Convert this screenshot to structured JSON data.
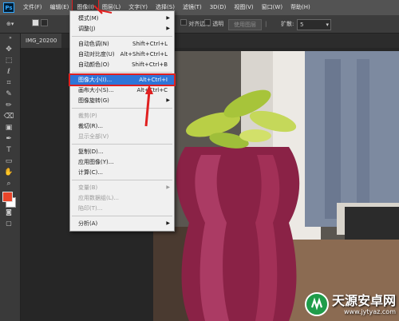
{
  "app": {
    "logo_text": "Ps"
  },
  "menubar": {
    "items": [
      "文件(F)",
      "编辑(E)",
      "图像(I)",
      "图层(L)",
      "文字(Y)",
      "选择(S)",
      "滤镜(T)",
      "3D(D)",
      "视图(V)",
      "窗口(W)",
      "帮助(H)"
    ],
    "active_index": 2
  },
  "options_bar": {
    "align_label": "对齐边缘",
    "transparent_label": "透明",
    "dropdown_value": "使用图层",
    "expand_label": "扩散:",
    "expand_value": "5"
  },
  "document": {
    "tab_title": "IMG_20200"
  },
  "image_menu": {
    "items": [
      {
        "label": "模式(M)",
        "shortcut": "",
        "submenu": true,
        "disabled": false
      },
      {
        "label": "调整(J)",
        "shortcut": "",
        "submenu": true,
        "disabled": false
      },
      {
        "label": "自动色调(N)",
        "shortcut": "Shift+Ctrl+L",
        "submenu": false,
        "disabled": false
      },
      {
        "label": "自动对比度(U)",
        "shortcut": "Alt+Shift+Ctrl+L",
        "submenu": false,
        "disabled": false
      },
      {
        "label": "自动颜色(O)",
        "shortcut": "Shift+Ctrl+B",
        "submenu": false,
        "disabled": false
      },
      {
        "label": "图像大小(I)...",
        "shortcut": "Alt+Ctrl+I",
        "submenu": false,
        "disabled": false,
        "highlighted": true
      },
      {
        "label": "画布大小(S)...",
        "shortcut": "Alt+Ctrl+C",
        "submenu": false,
        "disabled": false
      },
      {
        "label": "图像旋转(G)",
        "shortcut": "",
        "submenu": true,
        "disabled": false
      },
      {
        "label": "裁剪(P)",
        "shortcut": "",
        "submenu": false,
        "disabled": true
      },
      {
        "label": "裁切(R)...",
        "shortcut": "",
        "submenu": false,
        "disabled": false
      },
      {
        "label": "显示全部(V)",
        "shortcut": "",
        "submenu": false,
        "disabled": true
      },
      {
        "label": "复制(D)...",
        "shortcut": "",
        "submenu": false,
        "disabled": false
      },
      {
        "label": "应用图像(Y)...",
        "shortcut": "",
        "submenu": false,
        "disabled": false
      },
      {
        "label": "计算(C)...",
        "shortcut": "",
        "submenu": false,
        "disabled": false
      },
      {
        "label": "变量(B)",
        "shortcut": "",
        "submenu": true,
        "disabled": true
      },
      {
        "label": "应用数据组(L)...",
        "shortcut": "",
        "submenu": false,
        "disabled": true
      },
      {
        "label": "陷印(T)...",
        "shortcut": "",
        "submenu": false,
        "disabled": true
      },
      {
        "label": "分析(A)",
        "shortcut": "",
        "submenu": true,
        "disabled": false
      }
    ]
  },
  "watermark": {
    "title": "天源安卓网",
    "url": "www.jytyaz.com"
  },
  "colors": {
    "foreground": "#e8452a",
    "background": "#ffffff",
    "highlight": "#2f75d8",
    "annotation": "#e02020"
  }
}
